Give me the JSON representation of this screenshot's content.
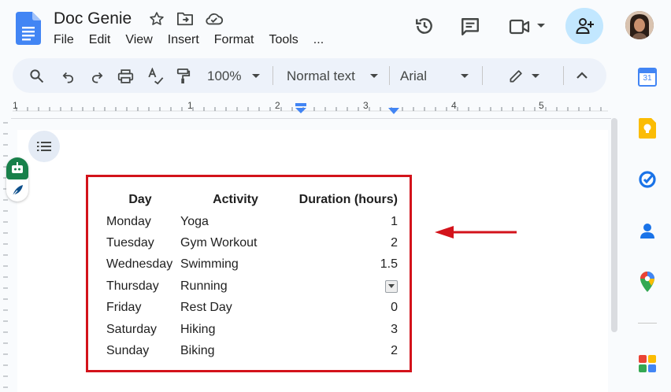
{
  "header": {
    "doc_title": "Doc Genie",
    "menu": [
      "File",
      "Edit",
      "View",
      "Insert",
      "Format",
      "Tools",
      "..."
    ]
  },
  "toolbar": {
    "zoom": "100%",
    "style": "Normal text",
    "font": "Arial"
  },
  "ruler": {
    "labels": [
      "1",
      "1",
      "2",
      "3",
      "4",
      "5"
    ]
  },
  "sidepanel": {
    "calendar_day": "31"
  },
  "table": {
    "headers": [
      "Day",
      "Activity",
      "Duration (hours)"
    ],
    "rows": [
      {
        "day": "Monday",
        "activity": "Yoga",
        "duration": "1"
      },
      {
        "day": "Tuesday",
        "activity": "Gym Workout",
        "duration": "2"
      },
      {
        "day": "Wednesday",
        "activity": "Swimming",
        "duration": "1.5"
      },
      {
        "day": "Thursday",
        "activity": "Running",
        "duration": ""
      },
      {
        "day": "Friday",
        "activity": "Rest Day",
        "duration": "0"
      },
      {
        "day": "Saturday",
        "activity": "Hiking",
        "duration": "3"
      },
      {
        "day": "Sunday",
        "activity": "Biking",
        "duration": "2"
      }
    ]
  },
  "colors": {
    "accent": "#0b57d0",
    "annotation": "#d3131b",
    "share_bg": "#c2e7ff",
    "toolbar_bg": "#edf2fa"
  }
}
